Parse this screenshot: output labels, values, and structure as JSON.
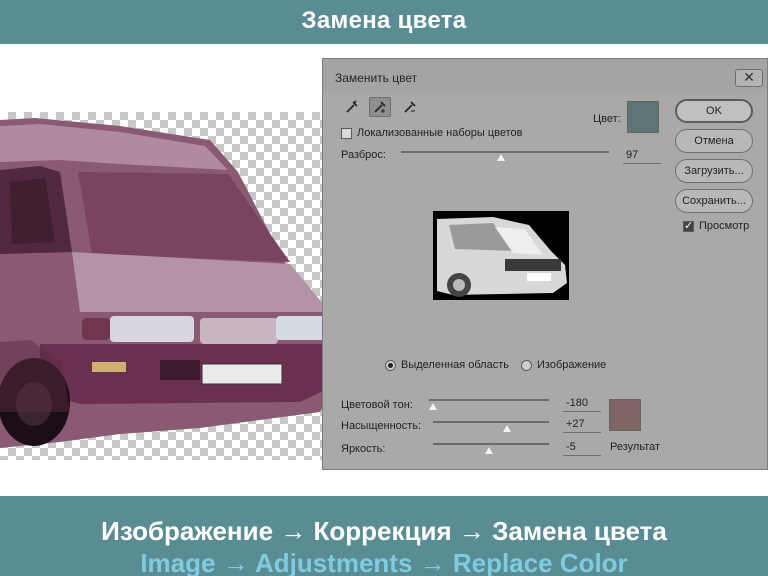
{
  "header": {
    "title": "Замена цвета"
  },
  "dialog": {
    "title": "Заменить цвет",
    "localized_label": "Локализованные наборы цветов",
    "fuzziness_label": "Разброс:",
    "fuzziness_value": "97",
    "color_label": "Цвет:",
    "selection_radio": "Выделенная область",
    "image_radio": "Изображение",
    "hue_label": "Цветовой тон:",
    "hue_value": "-180",
    "saturation_label": "Насыщенность:",
    "saturation_value": "+27",
    "lightness_label": "Яркость:",
    "lightness_value": "-5",
    "result_label": "Результат",
    "buttons": {
      "ok": "OK",
      "cancel": "Отмена",
      "load": "Загрузить...",
      "save": "Сохранить..."
    },
    "preview_label": "Просмотр",
    "close_icon": "close-icon",
    "tools": [
      "eyedropper-icon",
      "eyedropper-plus-icon",
      "eyedropper-minus-icon"
    ],
    "colors": {
      "selected_swatch": "#5e7575",
      "result_swatch": "#7f6464"
    }
  },
  "footer": {
    "russian": "Изображение → Коррекция → Замена цвета",
    "english": "Image → Adjustments → Replace Color"
  },
  "colors": {
    "bar": "#5a8c93",
    "english_text": "#7fcbe0"
  }
}
